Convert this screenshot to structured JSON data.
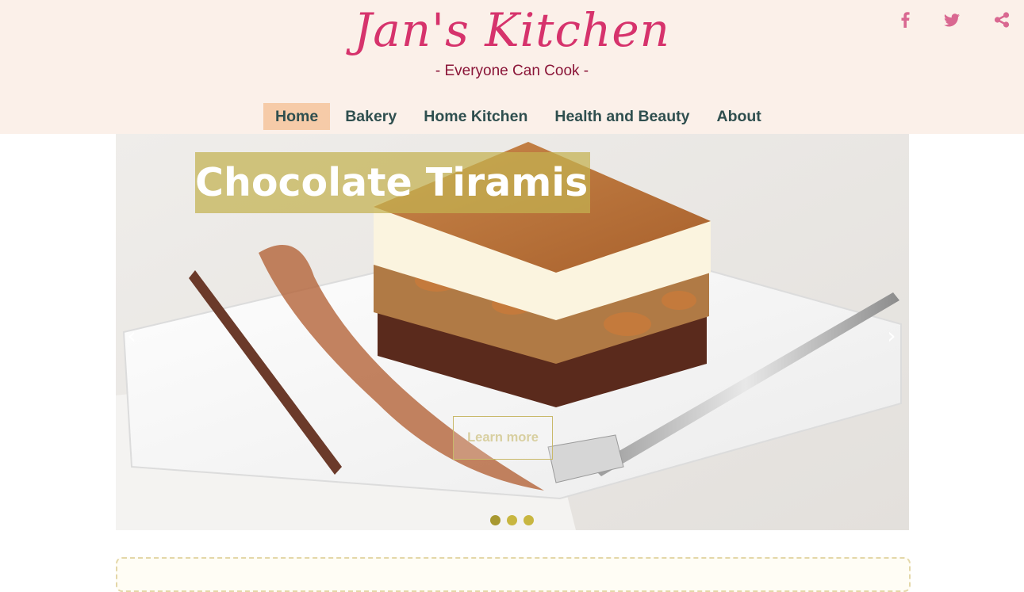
{
  "header": {
    "title": "Jan's Kitchen",
    "tagline": "- Everyone Can Cook -",
    "social": [
      {
        "icon": "facebook-icon"
      },
      {
        "icon": "twitter-icon"
      },
      {
        "icon": "share-icon"
      }
    ]
  },
  "nav": {
    "items": [
      {
        "label": "Home",
        "active": true
      },
      {
        "label": "Bakery",
        "active": false
      },
      {
        "label": "Home Kitchen",
        "active": false
      },
      {
        "label": "Health and Beauty",
        "active": false
      },
      {
        "label": "About",
        "active": false
      }
    ]
  },
  "carousel": {
    "slide_title": "Chocolate Tiramisu",
    "button_label": "Learn more",
    "prev_label": "‹",
    "next_label": "›",
    "slide_count": 3,
    "active_slide": 1
  },
  "colors": {
    "header_bg": "#fbf0e9",
    "brand_pink": "#d6336c",
    "nav_active_bg": "#f6cba8",
    "nav_text": "#2f4f4f",
    "title_band": "#c4b250"
  }
}
